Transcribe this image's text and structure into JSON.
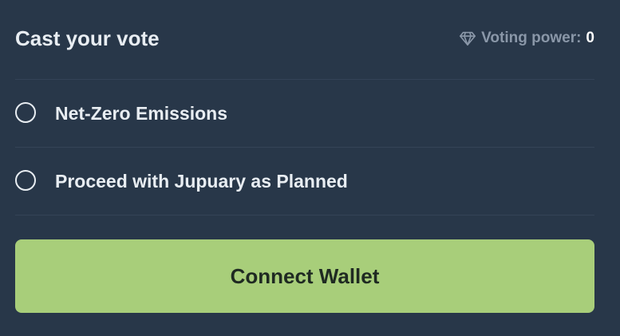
{
  "vote_panel": {
    "title": "Cast your vote",
    "voting_power": {
      "icon": "diamond-icon",
      "label": "Voting power:",
      "value": "0"
    },
    "options": [
      {
        "label": "Net-Zero Emissions",
        "selected": false
      },
      {
        "label": "Proceed with Jupuary as Planned",
        "selected": false
      }
    ],
    "connect_button": {
      "label": "Connect Wallet"
    }
  },
  "colors": {
    "background": "#283749",
    "divider": "#344357",
    "text_primary": "#e8edf2",
    "text_muted": "#8a97a8",
    "button_bg": "#a8ce7a",
    "button_text": "#1f2a22"
  }
}
